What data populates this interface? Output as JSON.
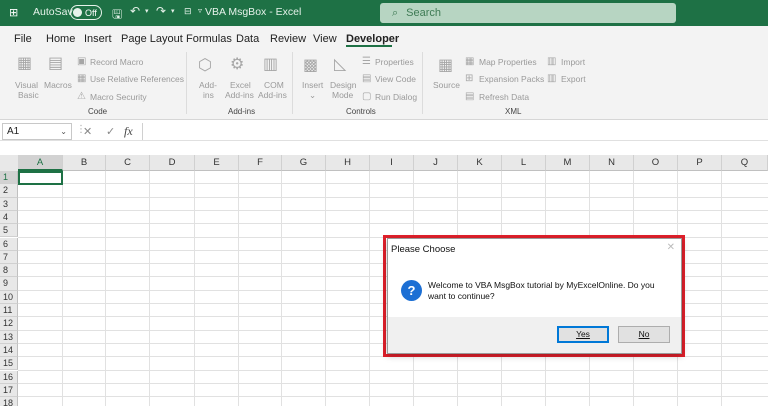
{
  "titlebar": {
    "autosave_label": "AutoSave",
    "autosave_state": "Off",
    "title": "VBA MsgBox  -  Excel",
    "search_placeholder": "Search",
    "accent": "#1e7145"
  },
  "menu": [
    "File",
    "Home",
    "Insert",
    "Page Layout",
    "Formulas",
    "Data",
    "Review",
    "View",
    "Developer"
  ],
  "menu_active": "Developer",
  "ribbon": {
    "code": {
      "label": "Code",
      "visual_basic": [
        "Visual",
        "Basic"
      ],
      "macros": "Macros",
      "record_macro": "Record Macro",
      "relative_refs": "Use Relative References",
      "macro_security": "Macro Security"
    },
    "addins": {
      "label": "Add-ins",
      "addins": [
        "Add-",
        "ins"
      ],
      "excel_addins": [
        "Excel",
        "Add-ins"
      ],
      "com_addins": [
        "COM",
        "Add-ins"
      ]
    },
    "controls": {
      "label": "Controls",
      "insert": "Insert",
      "design_mode": [
        "Design",
        "Mode"
      ],
      "properties": "Properties",
      "view_code": "View Code",
      "run_dialog": "Run Dialog"
    },
    "xml": {
      "label": "XML",
      "source": "Source",
      "map_properties": "Map Properties",
      "expansion_packs": "Expansion Packs",
      "refresh_data": "Refresh Data",
      "import": "Import",
      "export": "Export"
    }
  },
  "formula_bar": {
    "name_box": "A1",
    "fx": "fx",
    "value": ""
  },
  "grid": {
    "columns": [
      "A",
      "B",
      "C",
      "D",
      "E",
      "F",
      "G",
      "H",
      "I",
      "J",
      "K",
      "L",
      "M",
      "N",
      "O",
      "P",
      "Q"
    ],
    "rows": [
      "1",
      "2",
      "3",
      "4",
      "5",
      "6",
      "7",
      "8",
      "9",
      "10",
      "11",
      "12",
      "13",
      "14",
      "15",
      "16",
      "17",
      "18"
    ],
    "selected_cell": "A1"
  },
  "dialog": {
    "title": "Please Choose",
    "message": "Welcome to VBA MsgBox tutorial by MyExcelOnline. Do you want to continue?",
    "icon": "?",
    "yes_label": "Yes",
    "no_label": "No",
    "highlight_color": "#e0202b"
  }
}
